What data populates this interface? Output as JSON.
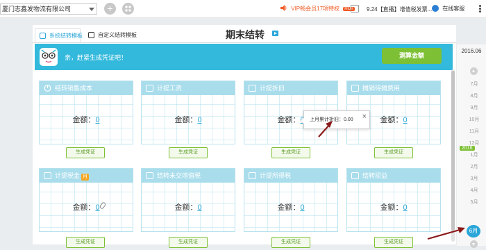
{
  "topbar": {
    "company": "厦门志鑫发物流有限公司",
    "add_label": "+",
    "vip_text": "VIP畅会员17项特权",
    "vip_badge": "HOT",
    "news": "9.24【直播】增值税发票...",
    "service": "在线客服"
  },
  "tabs": [
    {
      "label": "系统结转模板"
    },
    {
      "label": "自定义结转模板"
    }
  ],
  "page_title": "期末结转",
  "banner": {
    "message": "亲，赶紧生成凭证吧！",
    "calc_button": "测算金额"
  },
  "cards": [
    {
      "title": "结转销售成本",
      "amount_label": "金额：",
      "amount": "0",
      "button": "生成凭证"
    },
    {
      "title": "计提工资",
      "amount_label": "金额：",
      "amount": "0",
      "button": "生成凭证"
    },
    {
      "title": "计提折旧",
      "amount_label": "金额：",
      "amount": "0",
      "button": "生成凭证"
    },
    {
      "title": "摊销待摊费用",
      "amount_label": "金额：",
      "amount": "0",
      "button": "生成凭证"
    },
    {
      "title": "计提税金",
      "badge": "月",
      "amount_label": "金额：",
      "amount": "0",
      "button": "生成凭证"
    },
    {
      "title": "结转未交增值税",
      "amount_label": "金额：",
      "amount": "0",
      "button": "生成凭证"
    },
    {
      "title": "计提所得税",
      "amount_label": "金额：",
      "amount": "0",
      "button": "生成凭证"
    },
    {
      "title": "结转损益",
      "amount_label": "金额：",
      "amount": "0",
      "button": "生成凭证"
    }
  ],
  "tooltip": {
    "text": "上月累计折旧：0.00",
    "close": "×"
  },
  "period": {
    "current": "2016.06",
    "months_before": [
      "7月",
      "8月",
      "9月",
      "10月",
      "11月",
      "12月"
    ],
    "year_badge": "2016",
    "months_after": [
      "1月",
      "2月",
      "3月",
      "4月",
      "5月"
    ],
    "selected": "6月"
  },
  "colors": {
    "accent": "#2aa6d8",
    "banner": "#33b9dc",
    "green": "#7dc035",
    "card_head": "#a9ddec",
    "annotation": "#8b1a1a"
  }
}
